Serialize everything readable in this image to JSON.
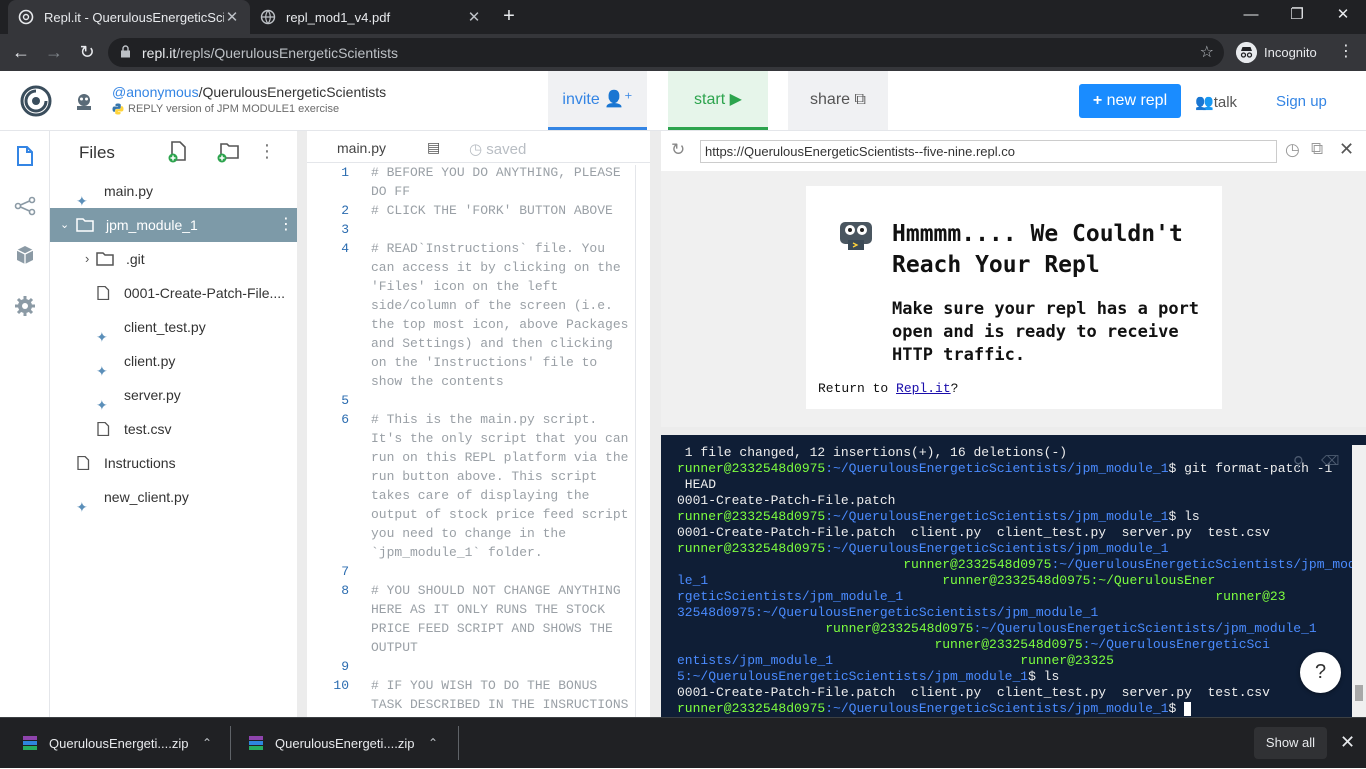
{
  "browser": {
    "tabs": [
      {
        "title": "Repl.it - QuerulousEnergeticScien",
        "close": "✕"
      },
      {
        "title": "repl_mod1_v4.pdf",
        "close": "✕"
      }
    ],
    "new_tab": "+",
    "window": {
      "min": "—",
      "max": "❐",
      "close": "✕"
    },
    "url_host": "repl.it",
    "url_path": "/repls/QuerulousEnergeticScientists",
    "incognito_label": "Incognito",
    "colors": {
      "bar": "#202124",
      "toolbar": "#35363a"
    }
  },
  "header": {
    "user": "@anonymous",
    "repl_name": "/QuerulousEnergeticScientists",
    "subtitle": "REPLY version of JPM MODULE1 exercise",
    "invite": "invite",
    "start": "start",
    "share": "share",
    "new_repl": "new repl",
    "talk": "talk",
    "signup": "Sign up",
    "colors": {
      "accent": "#3485e4",
      "start": "#2da44e",
      "new_repl_bg": "#1a8cff"
    }
  },
  "files": {
    "title": "Files",
    "items": [
      {
        "name": "main.py",
        "icon": "python-icon"
      },
      {
        "name": "jpm_module_1",
        "icon": "folder-icon"
      },
      {
        "name": ".git",
        "icon": "folder-icon"
      },
      {
        "name": "0001-Create-Patch-File....",
        "icon": "file-icon"
      },
      {
        "name": "client_test.py",
        "icon": "python-icon"
      },
      {
        "name": "client.py",
        "icon": "python-icon"
      },
      {
        "name": "server.py",
        "icon": "python-icon"
      },
      {
        "name": "test.csv",
        "icon": "file-icon"
      },
      {
        "name": "Instructions",
        "icon": "file-icon"
      },
      {
        "name": "new_client.py",
        "icon": "python-icon"
      }
    ]
  },
  "editor": {
    "tab": "main.py",
    "saved": "saved",
    "lines": [
      {
        "n": "1",
        "text": "# BEFORE YOU DO ANYTHING, PLEASE DO FF"
      },
      {
        "n": "2",
        "text": "# CLICK THE 'FORK' BUTTON ABOVE"
      },
      {
        "n": "3",
        "text": ""
      },
      {
        "n": "4",
        "text": "# READ`Instructions` file. You can access it by clicking on the 'Files' icon on the left side/column of the screen (i.e. the top most icon, above Packages and Settings) and then clicking on the 'Instructions' file to show the contents"
      },
      {
        "n": "5",
        "text": ""
      },
      {
        "n": "6",
        "text": "# This is the main.py script. It's the only script that you can run on this REPL platform via the run button above. This script takes care of displaying the output of stock price feed script you need to change in the `jpm_module_1` folder."
      },
      {
        "n": "7",
        "text": ""
      },
      {
        "n": "8",
        "text": "# YOU SHOULD NOT CHANGE ANYTHING HERE AS IT ONLY RUNS THE STOCK PRICE FEED SCRIPT AND SHOWS THE OUTPUT"
      },
      {
        "n": "9",
        "text": ""
      },
      {
        "n": "10",
        "text": "# IF YOU WISH TO DO THE BONUS TASK DESCRIBED IN THE INSRUCTIONS"
      }
    ]
  },
  "preview": {
    "url": "https://QuerulousEnergeticScientists--five-nine.repl.co",
    "heading": "Hmmmm.... We Couldn't Reach Your Repl",
    "body": "Make sure your repl has a port open and is ready to receive HTTP traffic.",
    "return_prefix": "Return to ",
    "return_link": "Repl.it",
    "return_suffix": "?"
  },
  "terminal": {
    "lines": [
      {
        "u": "",
        "p": "",
        "t": " 1 file changed, 12 insertions(+), 16 deletions(-)"
      },
      {
        "u": "runner@2332548d0975",
        "p": ":~/QuerulousEnergeticScientists/jpm_module_1",
        "t": "$ git format-patch -1"
      },
      {
        "u": "",
        "p": "",
        "t": " HEAD"
      },
      {
        "u": "",
        "p": "",
        "t": "0001-Create-Patch-File.patch"
      },
      {
        "u": "runner@2332548d0975",
        "p": ":~/QuerulousEnergeticScientists/jpm_module_1",
        "t": "$ ls"
      },
      {
        "u": "",
        "p": "",
        "t": "0001-Create-Patch-File.patch  client.py  client_test.py  server.py  test.csv"
      },
      {
        "u": "runner@2332548d0975",
        "p": ":~/QuerulousEnergeticScientists/jpm_module_1",
        "t": ""
      },
      {
        "u": "                             runner@2332548d0975",
        "p": ":~/QuerulousEnergeticScientists/jpm_modu",
        "t": ""
      },
      {
        "u": "",
        "p": "le_1",
        "t": "",
        "tail": "                              runner@2332548d0975:~/QuerulousEner"
      },
      {
        "u": "",
        "p": "rgeticScientists/jpm_module_1",
        "t": "",
        "tail": "                                        runner@23"
      },
      {
        "u": "",
        "p": "32548d0975:~/QuerulousEnergeticScientists/jpm_module_1",
        "t": ""
      },
      {
        "u": "                   runner@2332548d0975",
        "p": ":~/QuerulousEnergeticScientists/jpm_module_1",
        "t": ""
      },
      {
        "u": "                                 runner@2332548d0975",
        "p": ":~/QuerulousEnergeticSci",
        "t": ""
      },
      {
        "u": "",
        "p": "entists/jpm_module_1",
        "t": "",
        "tail": "                        runner@23325"
      },
      {
        "u": "",
        "p": "5:~/QuerulousEnergeticScientists/jpm_module_1",
        "t": "$ ls"
      },
      {
        "u": "",
        "p": "",
        "t": "0001-Create-Patch-File.patch  client.py  client_test.py  server.py  test.csv"
      },
      {
        "u": "runner@2332548d0975",
        "p": ":~/QuerulousEnergeticScientists/jpm_module_1",
        "t": "$ "
      }
    ],
    "help": "?"
  },
  "downloads": {
    "items": [
      {
        "name": "QuerulousEnergeti....zip"
      },
      {
        "name": "QuerulousEnergeti....zip"
      }
    ],
    "show_all": "Show all",
    "close": "✕"
  }
}
